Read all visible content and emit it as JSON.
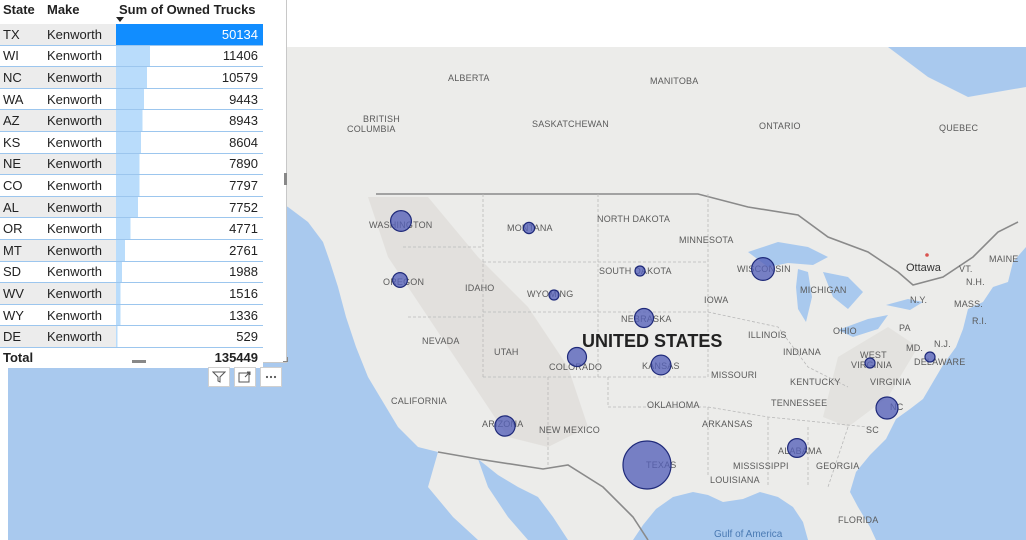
{
  "table": {
    "headers": {
      "state": "State",
      "make": "Make",
      "value": "Sum of Owned Trucks"
    },
    "rows": [
      {
        "state": "TX",
        "make": "Kenworth",
        "value": "50134",
        "fraction": 1.0
      },
      {
        "state": "WI",
        "make": "Kenworth",
        "value": "11406",
        "fraction": 0.2275
      },
      {
        "state": "NC",
        "make": "Kenworth",
        "value": "10579",
        "fraction": 0.211
      },
      {
        "state": "WA",
        "make": "Kenworth",
        "value": "9443",
        "fraction": 0.1884
      },
      {
        "state": "AZ",
        "make": "Kenworth",
        "value": "8943",
        "fraction": 0.1784
      },
      {
        "state": "KS",
        "make": "Kenworth",
        "value": "8604",
        "fraction": 0.1716
      },
      {
        "state": "NE",
        "make": "Kenworth",
        "value": "7890",
        "fraction": 0.1574
      },
      {
        "state": "CO",
        "make": "Kenworth",
        "value": "7797",
        "fraction": 0.1555
      },
      {
        "state": "AL",
        "make": "Kenworth",
        "value": "7752",
        "fraction": 0.1546
      },
      {
        "state": "OR",
        "make": "Kenworth",
        "value": "4771",
        "fraction": 0.0952
      },
      {
        "state": "MT",
        "make": "Kenworth",
        "value": "2761",
        "fraction": 0.0551
      },
      {
        "state": "SD",
        "make": "Kenworth",
        "value": "1988",
        "fraction": 0.0397
      },
      {
        "state": "WV",
        "make": "Kenworth",
        "value": "1516",
        "fraction": 0.0302
      },
      {
        "state": "WY",
        "make": "Kenworth",
        "value": "1336",
        "fraction": 0.0266
      },
      {
        "state": "DE",
        "make": "Kenworth",
        "value": "529",
        "fraction": 0.0106
      }
    ],
    "total_label": "Total",
    "total_value": "135449",
    "sort_indicator": "sort-descending-icon",
    "colors": {
      "top_bar": "#118dff",
      "bar": "#b9dcfb"
    }
  },
  "visual_header": {
    "icons": [
      "filter-icon",
      "focus-mode-icon",
      "more-options-icon"
    ]
  },
  "map": {
    "country_label": "UNITED STATES",
    "city_label": "Ottawa",
    "water_label": "Gulf of America",
    "region_labels": {
      "alberta": "ALBERTA",
      "manitoba": "MANITOBA",
      "saskatchewan": "SASKATCHEWAN",
      "british_columbia_1": "BRITISH",
      "british_columbia_2": "COLUMBIA",
      "ontario": "ONTARIO",
      "quebec": "QUEBEC",
      "north_dakota": "NORTH DAKOTA",
      "minnesota": "MINNESOTA",
      "washington": "WASHINGTON",
      "montana": "MONTANA",
      "south_dakota": "SOUTH DAKOTA",
      "wisconsin": "WISCONSIN",
      "maine": "MAINE",
      "vt": "VT.",
      "nh": "N.H.",
      "oregon": "OREGON",
      "idaho": "IDAHO",
      "wyoming": "WYOMING",
      "michigan": "MICHIGAN",
      "ny": "N.Y.",
      "mass": "MASS.",
      "ri": "R.I.",
      "iowa": "IOWA",
      "nebraska": "NEBRASKA",
      "nevada": "NEVADA",
      "utah": "UTAH",
      "illinois": "ILLINOIS",
      "ohio": "OHIO",
      "pa": "PA",
      "nj": "N.J.",
      "md": "MD.",
      "colorado": "COLORADO",
      "kansas": "KANSAS",
      "indiana": "INDIANA",
      "west_1": "WEST",
      "west_2": "VIRGINIA",
      "delaware": "DELAWARE",
      "missouri": "MISSOURI",
      "kentucky": "KENTUCKY",
      "virginia": "VIRGINIA",
      "california": "CALIFORNIA",
      "oklahoma": "OKLAHOMA",
      "tennessee": "TENNESSEE",
      "nc": "NC",
      "arizona": "ARIZONA",
      "new_mexico": "NEW MEXICO",
      "arkansas": "ARKANSAS",
      "sc": "SC",
      "alabama": "ALABAMA",
      "texas": "TEXAS",
      "mississippi": "MISSISSIPPI",
      "georgia": "GEORGIA",
      "louisiana": "LOUISIANA",
      "florida": "FLORIDA"
    },
    "colors": {
      "land": "#ececea",
      "water": "#a9c9ee",
      "bubble": "#5560b8"
    }
  }
}
